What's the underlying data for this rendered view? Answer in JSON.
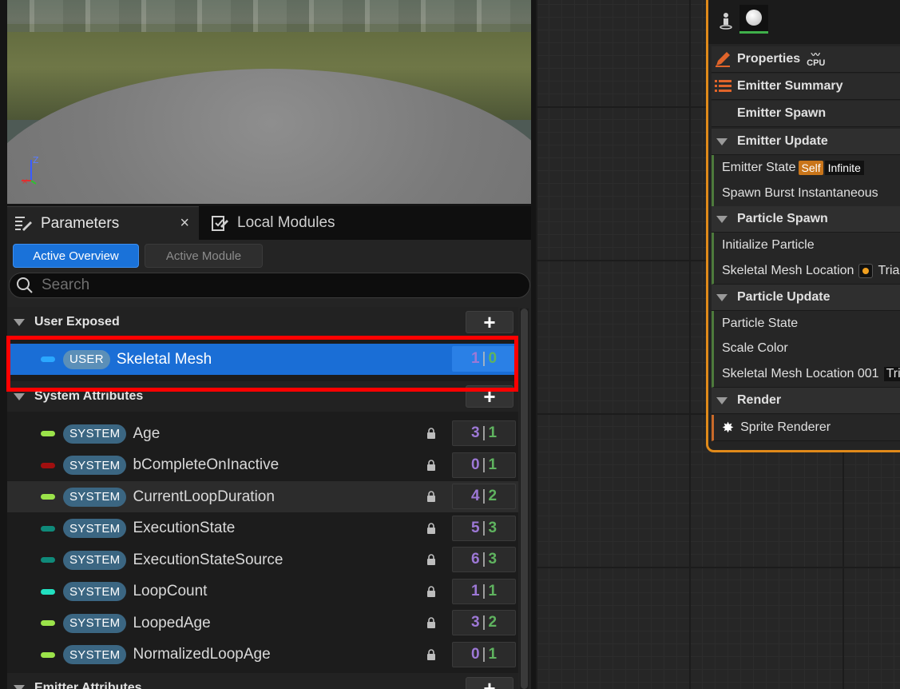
{
  "viewport": {
    "axis_label": "Z"
  },
  "tabs": {
    "parameters_label": "Parameters",
    "local_modules_label": "Local Modules",
    "close_glyph": "×"
  },
  "modes": {
    "active_overview": "Active Overview",
    "active_module": "Active Module"
  },
  "search": {
    "placeholder": "Search"
  },
  "sections": {
    "user_exposed": "User Exposed",
    "system_attributes": "System Attributes",
    "emitter_attributes": "Emitter Attributes",
    "add_glyph": "+"
  },
  "user_rows": [
    {
      "badge": "USER",
      "name": "Skeletal Mesh",
      "a": "1",
      "b": "0",
      "color": "#2aa7ff"
    }
  ],
  "system_rows": [
    {
      "badge": "SYSTEM",
      "name": "Age",
      "a": "3",
      "b": "1",
      "color": "#9be34a"
    },
    {
      "badge": "SYSTEM",
      "name": "bCompleteOnInactive",
      "a": "0",
      "b": "1",
      "color": "#a00f0f"
    },
    {
      "badge": "SYSTEM",
      "name": "CurrentLoopDuration",
      "a": "4",
      "b": "2",
      "color": "#9be34a"
    },
    {
      "badge": "SYSTEM",
      "name": "ExecutionState",
      "a": "5",
      "b": "3",
      "color": "#0f8a7a"
    },
    {
      "badge": "SYSTEM",
      "name": "ExecutionStateSource",
      "a": "6",
      "b": "3",
      "color": "#0f8a7a"
    },
    {
      "badge": "SYSTEM",
      "name": "LoopCount",
      "a": "1",
      "b": "1",
      "color": "#22e0c0"
    },
    {
      "badge": "SYSTEM",
      "name": "LoopedAge",
      "a": "3",
      "b": "2",
      "color": "#9be34a"
    },
    {
      "badge": "SYSTEM",
      "name": "NormalizedLoopAge",
      "a": "0",
      "b": "1",
      "color": "#9be34a"
    }
  ],
  "count_separator": "|",
  "node": {
    "properties": "Properties",
    "cpu": "CPU",
    "emitter_summary": "Emitter Summary",
    "emitter_spawn": "Emitter Spawn",
    "emitter_update": "Emitter Update",
    "emitter_state": "Emitter State",
    "self_tag": "Self",
    "infinite_tag": "Infinite",
    "spawn_burst": "Spawn Burst Instantaneous",
    "particle_spawn": "Particle Spawn",
    "initialize_particle": "Initialize Particle",
    "skeletal_mesh_location": "Skeletal Mesh Location",
    "tria_cut": "Tria",
    "particle_update": "Particle Update",
    "particle_state": "Particle State",
    "scale_color": "Scale Color",
    "skeletal_mesh_location_001": "Skeletal Mesh Location 001",
    "tri_cut": "Tri",
    "render": "Render",
    "sprite_renderer": "Sprite Renderer"
  },
  "colors": {
    "accent_blue": "#1a72d9",
    "highlight_red": "#ff0000",
    "node_orange": "#e08a1a"
  }
}
